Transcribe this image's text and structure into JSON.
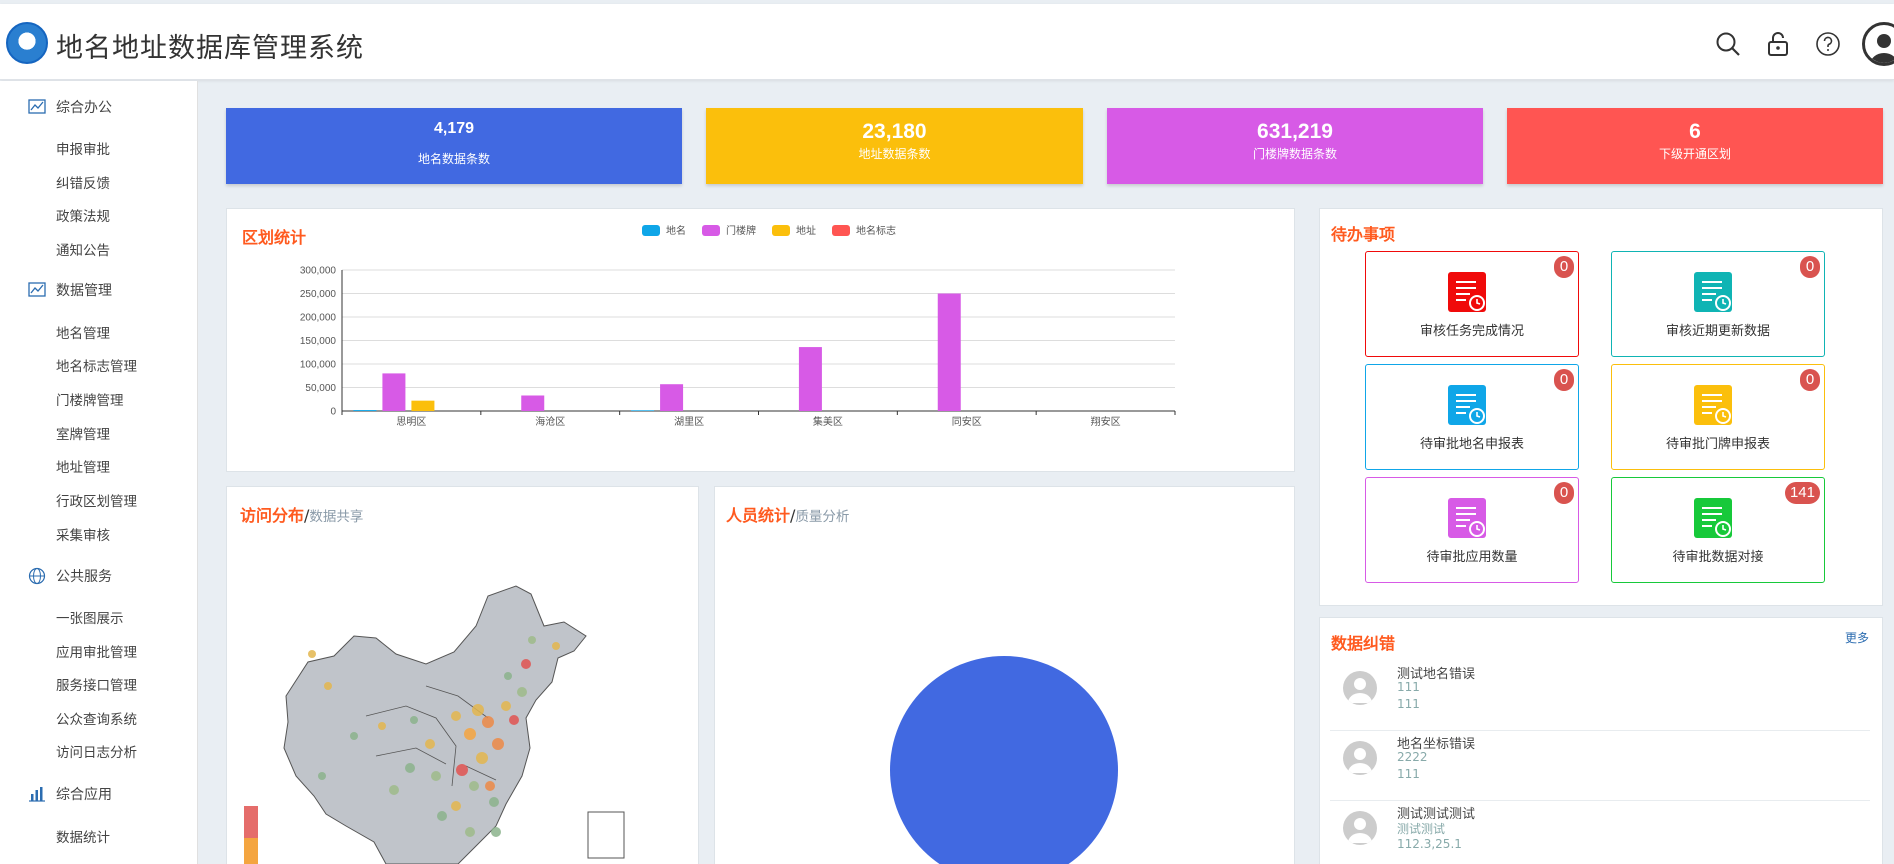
{
  "app": {
    "title": "地名地址数据库管理系统"
  },
  "header_icons": [
    "search-icon",
    "lock-icon",
    "help-icon",
    "user-icon"
  ],
  "sidebar": {
    "groups": [
      {
        "label": "综合办公",
        "icon": "chart-icon",
        "items": [
          "申报审批",
          "纠错反馈",
          "政策法规",
          "通知公告"
        ]
      },
      {
        "label": "数据管理",
        "icon": "chart-icon",
        "items": [
          "地名管理",
          "地名标志管理",
          "门楼牌管理",
          "室牌管理",
          "地址管理",
          "行政区划管理",
          "采集审核"
        ]
      },
      {
        "label": "公共服务",
        "icon": "globe-icon",
        "items": [
          "一张图展示",
          "应用审批管理",
          "服务接口管理",
          "公众查询系统",
          "访问日志分析"
        ]
      },
      {
        "label": "综合应用",
        "icon": "bar-chart-icon",
        "items": [
          "数据统计"
        ]
      }
    ]
  },
  "stats": [
    {
      "value": "4,179",
      "label": "地名数据条数",
      "color": "#4169e1"
    },
    {
      "value": "23,180",
      "label": "地址数据条数",
      "color": "#fbbf0c"
    },
    {
      "value": "631,219",
      "label": "门楼牌数据条数",
      "color": "#d75ae6"
    },
    {
      "value": "6",
      "label": "下级开通区划",
      "color": "#ff5552"
    }
  ],
  "district_panel": {
    "title": "区划统计"
  },
  "chart_data": {
    "type": "bar",
    "categories": [
      "思明区",
      "海沧区",
      "湖里区",
      "集美区",
      "同安区",
      "翔安区"
    ],
    "series": [
      {
        "name": "地名",
        "color": "#0fa6e8",
        "values": [
          2000,
          0,
          1500,
          0,
          0,
          0
        ]
      },
      {
        "name": "门楼牌",
        "color": "#d75ae6",
        "values": [
          80000,
          33000,
          57000,
          136000,
          250000,
          0
        ]
      },
      {
        "name": "地址",
        "color": "#fbbf0c",
        "values": [
          22000,
          0,
          0,
          0,
          0,
          0
        ]
      },
      {
        "name": "地名标志",
        "color": "#ff5552",
        "values": [
          0,
          0,
          0,
          0,
          0,
          0
        ]
      }
    ],
    "yticks": [
      "0",
      "50,000",
      "100,000",
      "150,000",
      "200,000",
      "250,000",
      "300,000"
    ],
    "ylim": [
      0,
      300000
    ],
    "legend": "top-center",
    "grid": true
  },
  "visit_panel": {
    "title": "访问分布",
    "sep": "/",
    "sub": "数据共享"
  },
  "staff_panel": {
    "title": "人员统计",
    "sep": "/",
    "sub": "质量分析",
    "pie_color": "#4169e1"
  },
  "todo_panel": {
    "title": "待办事项",
    "items": [
      {
        "label": "审核任务完成情况",
        "badge": "0",
        "color": "#f00a0a"
      },
      {
        "label": "审核近期更新数据",
        "badge": "0",
        "color": "#0fb4b4"
      },
      {
        "label": "待审批地名申报表",
        "badge": "0",
        "color": "#0fa6e8"
      },
      {
        "label": "待审批门牌申报表",
        "badge": "0",
        "color": "#fbbf0c"
      },
      {
        "label": "待审批应用数量",
        "badge": "0",
        "color": "#d75ae6"
      },
      {
        "label": "待审批数据对接",
        "badge": "141",
        "color": "#17c93a"
      }
    ]
  },
  "corrections_panel": {
    "title": "数据纠错",
    "more": "更多",
    "items": [
      {
        "title": "测试地名错误",
        "line2": "111",
        "line3": "111"
      },
      {
        "title": "地名坐标错误",
        "line2": "2222",
        "line3": "111"
      },
      {
        "title": "测试测试测试",
        "line2": "测试测试",
        "line3": "112.3,25.1"
      }
    ]
  }
}
